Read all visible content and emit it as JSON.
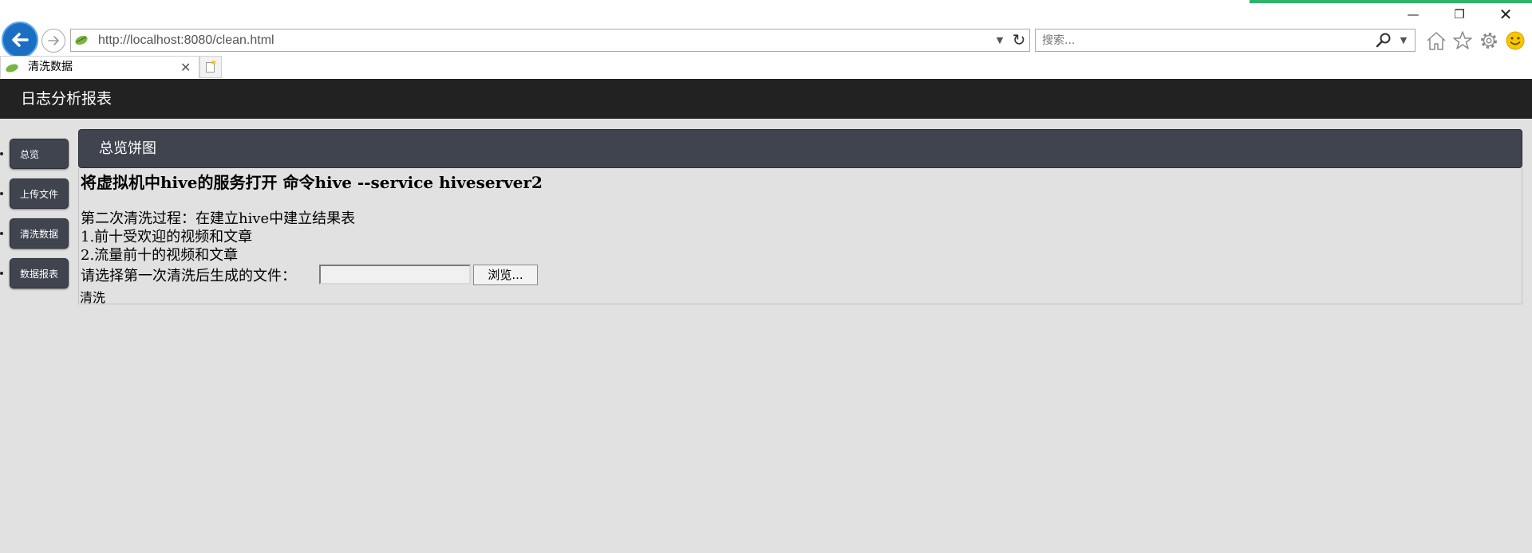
{
  "browser": {
    "url": "http://localhost:8080/clean.html",
    "search_placeholder": "搜索...",
    "tab_title": "清洗数据",
    "colors": {
      "back_button": "#1a6fc4",
      "progress": "#2fb36b"
    },
    "icons": [
      "back-arrow-icon",
      "forward-arrow-icon",
      "refresh-icon",
      "search-icon",
      "home-icon",
      "star-icon",
      "gear-icon",
      "smile-icon",
      "close-icon",
      "new-tab-icon"
    ]
  },
  "header": {
    "title": "日志分析报表"
  },
  "sidebar": {
    "items": [
      {
        "label": "总览"
      },
      {
        "label": "上传文件"
      },
      {
        "label": "清洗数据"
      },
      {
        "label": "数据报表"
      }
    ]
  },
  "main": {
    "panel_title": "总览饼图",
    "heading": "将虚拟机中hive的服务打开 命令hive --service hiveserver2",
    "description": "第二次清洗过程：在建立hive中建立结果表",
    "items": [
      "1.前十受欢迎的视频和文章",
      "2.流量前十的视频和文章"
    ],
    "file_label": "请选择第一次清洗后生成的文件：",
    "browse_label": "浏览...",
    "clean_label": "清洗"
  },
  "theme": {
    "nav_bg": "#222222",
    "panel_bg": "#3f444e",
    "page_bg": "#e1e1e1"
  }
}
